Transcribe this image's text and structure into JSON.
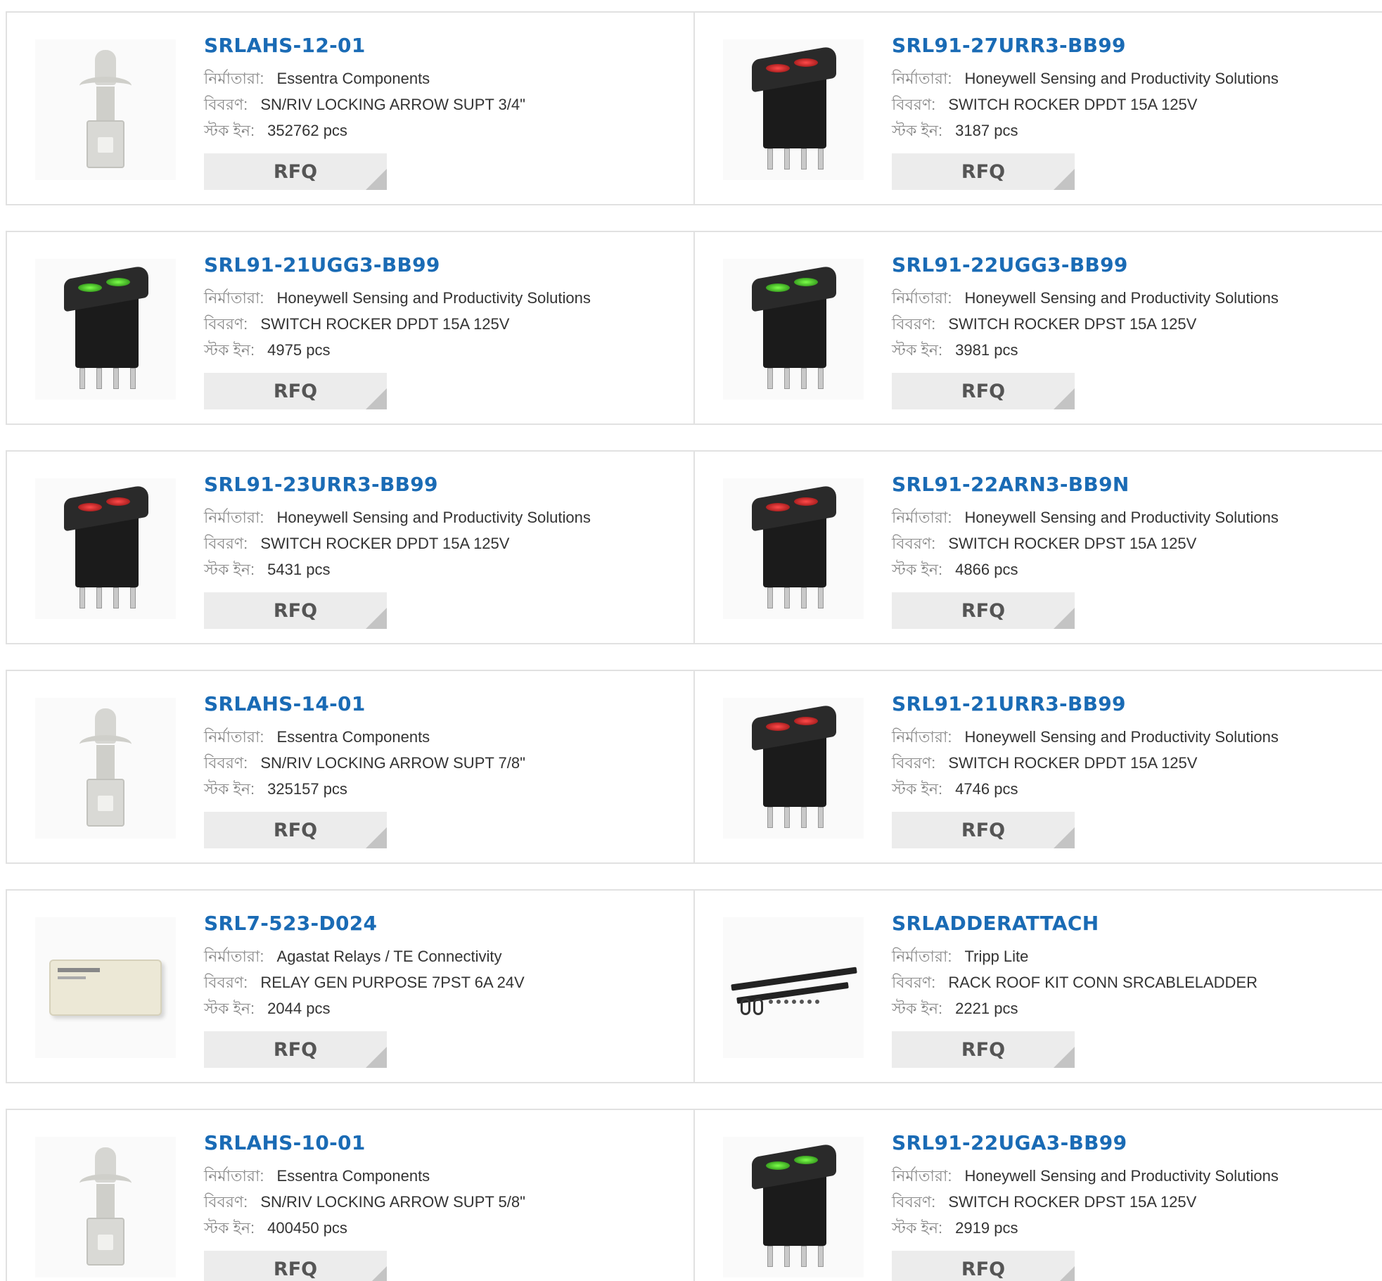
{
  "labels": {
    "manufacturer": "নির্মাতারা:",
    "description": "বিবরণ:",
    "stock": "স্টক ইন:",
    "rfq": "RFQ"
  },
  "colors": {
    "part_link": "#1a6bb5",
    "border": "#e1e1e1",
    "rfq_bg": "#ececec"
  },
  "products": [
    {
      "part": "SRLAHS-12-01",
      "manufacturer": "Essentra Components",
      "description": "SN/RIV LOCKING ARROW SUPT 3/4\"",
      "stock": "352762 pcs",
      "image": "arrow-support-icon"
    },
    {
      "part": "SRL91-27URR3-BB99",
      "manufacturer": "Honeywell Sensing and Productivity Solutions",
      "description": "SWITCH ROCKER DPDT 15A 125V",
      "stock": "3187 pcs",
      "image": "rocker-switch-red-icon"
    },
    {
      "part": "SRL91-21UGG3-BB99",
      "manufacturer": "Honeywell Sensing and Productivity Solutions",
      "description": "SWITCH ROCKER DPDT 15A 125V",
      "stock": "4975 pcs",
      "image": "rocker-switch-green-icon"
    },
    {
      "part": "SRL91-22UGG3-BB99",
      "manufacturer": "Honeywell Sensing and Productivity Solutions",
      "description": "SWITCH ROCKER DPST 15A 125V",
      "stock": "3981 pcs",
      "image": "rocker-switch-green-icon"
    },
    {
      "part": "SRL91-23URR3-BB99",
      "manufacturer": "Honeywell Sensing and Productivity Solutions",
      "description": "SWITCH ROCKER DPDT 15A 125V",
      "stock": "5431 pcs",
      "image": "rocker-switch-red-icon"
    },
    {
      "part": "SRL91-22ARN3-BB9N",
      "manufacturer": "Honeywell Sensing and Productivity Solutions",
      "description": "SWITCH ROCKER DPST 15A 125V",
      "stock": "4866 pcs",
      "image": "rocker-switch-red-icon"
    },
    {
      "part": "SRLAHS-14-01",
      "manufacturer": "Essentra Components",
      "description": "SN/RIV LOCKING ARROW SUPT 7/8\"",
      "stock": "325157 pcs",
      "image": "arrow-support-icon"
    },
    {
      "part": "SRL91-21URR3-BB99",
      "manufacturer": "Honeywell Sensing and Productivity Solutions",
      "description": "SWITCH ROCKER DPDT 15A 125V",
      "stock": "4746 pcs",
      "image": "rocker-switch-red-icon"
    },
    {
      "part": "SRL7-523-D024",
      "manufacturer": "Agastat Relays / TE Connectivity",
      "description": "RELAY GEN PURPOSE 7PST 6A 24V",
      "stock": "2044 pcs",
      "image": "relay-icon"
    },
    {
      "part": "SRLADDERATTACH",
      "manufacturer": "Tripp Lite",
      "description": "RACK ROOF KIT CONN SRCABLELADDER",
      "stock": "2221 pcs",
      "image": "ladder-kit-icon"
    },
    {
      "part": "SRLAHS-10-01",
      "manufacturer": "Essentra Components",
      "description": "SN/RIV LOCKING ARROW SUPT 5/8\"",
      "stock": "400450 pcs",
      "image": "arrow-support-icon"
    },
    {
      "part": "SRL91-22UGA3-BB99",
      "manufacturer": "Honeywell Sensing and Productivity Solutions",
      "description": "SWITCH ROCKER DPST 15A 125V",
      "stock": "2919 pcs",
      "image": "rocker-switch-green-icon"
    }
  ]
}
